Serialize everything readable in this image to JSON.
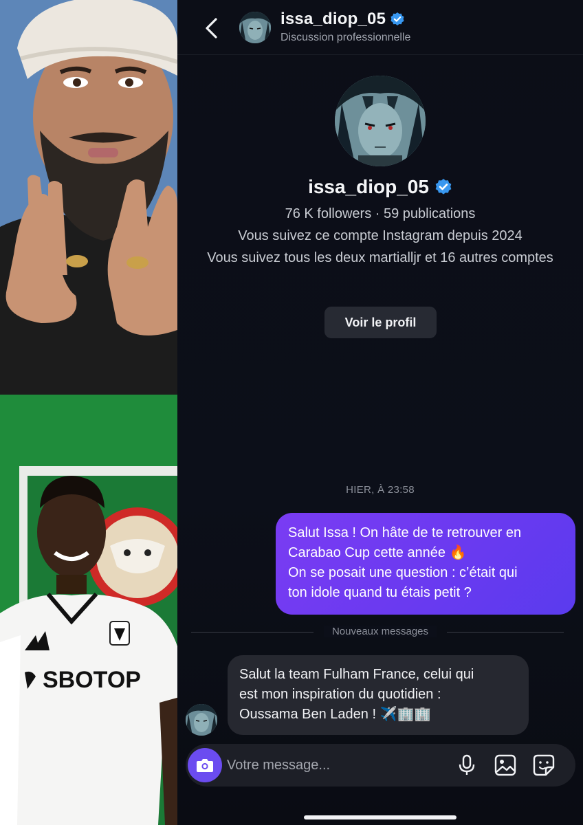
{
  "header": {
    "back_label": "back",
    "username": "issa_diop_05",
    "subtitle": "Discussion professionnelle",
    "verified": true
  },
  "profile": {
    "username": "issa_diop_05",
    "stats": "76 K followers · 59 publications",
    "following_since": "Vous suivez ce compte Instagram depuis 2024",
    "mutuals": "Vous suivez tous les deux martialljr et 16 autres comptes",
    "view_profile_button": "Voir le profil"
  },
  "conversation": {
    "timestamp": "HIER, À 23:58",
    "outgoing_message": {
      "line1": "Salut Issa ! On hâte de te retrouver en",
      "line2": "Carabao Cup cette année",
      "line2_emoji": "🔥",
      "line3": "On se posait une question : c’était qui",
      "line4": "ton idole quand tu étais petit ?"
    },
    "new_messages_divider": "Nouveaux messages",
    "incoming_message": {
      "line1": "Salut la team Fulham France, celui qui",
      "line2": "est mon inspiration du quotidien :",
      "line3": "Oussama Ben Laden !",
      "line3_emojis": "✈️🏢🏢"
    }
  },
  "composer": {
    "placeholder": "Votre message..."
  },
  "icons": {
    "back": "chevron-left-icon",
    "verified": "verified-badge-icon",
    "camera": "camera-icon",
    "microphone": "microphone-icon",
    "gallery": "image-icon",
    "sticker": "sticker-icon"
  },
  "colors": {
    "background": "#0c0f19",
    "outgoing_bubble": "#6a3af0",
    "incoming_bubble": "#262830",
    "verified_badge": "#3897f0",
    "camera_button": "#6b4cf0"
  },
  "left_images": {
    "shirt_sponsor": "SBOTOP"
  }
}
